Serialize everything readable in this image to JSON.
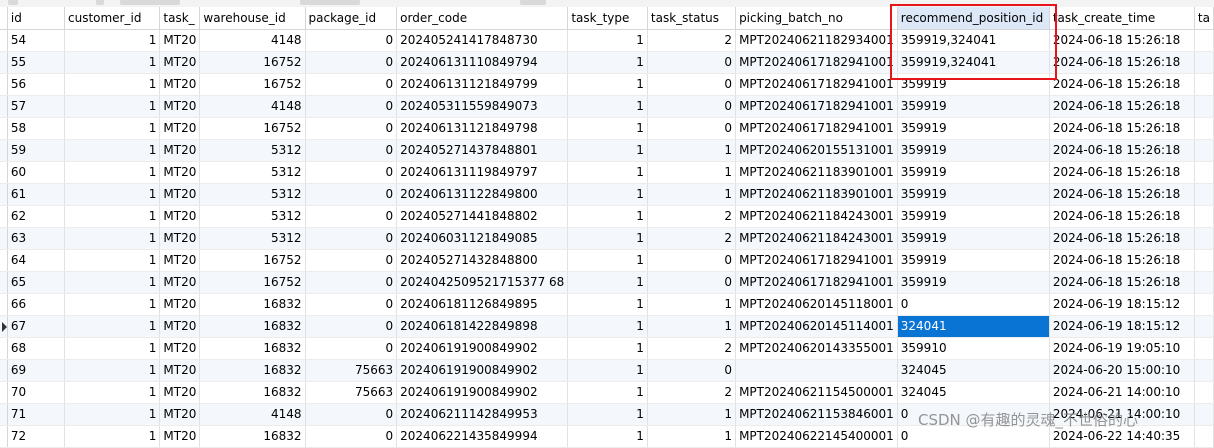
{
  "columns": [
    {
      "key": "id",
      "label": "id",
      "align": "left"
    },
    {
      "key": "customer_id",
      "label": "customer_id",
      "align": "right"
    },
    {
      "key": "task",
      "label": "task_",
      "align": "left"
    },
    {
      "key": "warehouse_id",
      "label": "warehouse_id",
      "align": "right"
    },
    {
      "key": "package_id",
      "label": "package_id",
      "align": "right"
    },
    {
      "key": "order_code",
      "label": "order_code",
      "align": "left"
    },
    {
      "key": "task_type",
      "label": "task_type",
      "align": "right"
    },
    {
      "key": "task_status",
      "label": "task_status",
      "align": "right"
    },
    {
      "key": "picking_batch_no",
      "label": "picking_batch_no",
      "align": "left"
    },
    {
      "key": "recommend_position_id",
      "label": "recommend_position_id",
      "align": "left"
    },
    {
      "key": "task_create_time",
      "label": "task_create_time",
      "align": "left"
    },
    {
      "key": "extra",
      "label": "ta",
      "align": "left"
    }
  ],
  "rows": [
    {
      "id": "54",
      "customer_id": "1",
      "task": "MT20",
      "warehouse_id": "4148",
      "package_id": "0",
      "order_code": "202405241417848730",
      "task_type": "1",
      "task_status": "2",
      "picking_batch_no": "MPT20240621182934001",
      "recommend_position_id": "359919,324041",
      "task_create_time": "2024-06-18 15:26:18",
      "extra": ""
    },
    {
      "id": "55",
      "customer_id": "1",
      "task": "MT20",
      "warehouse_id": "16752",
      "package_id": "0",
      "order_code": "202406131110849794",
      "task_type": "1",
      "task_status": "0",
      "picking_batch_no": "MPT20240617182941001",
      "recommend_position_id": "359919,324041",
      "task_create_time": "2024-06-18 15:26:18",
      "extra": ""
    },
    {
      "id": "56",
      "customer_id": "1",
      "task": "MT20",
      "warehouse_id": "16752",
      "package_id": "0",
      "order_code": "202406131121849799",
      "task_type": "1",
      "task_status": "0",
      "picking_batch_no": "MPT20240617182941001",
      "recommend_position_id": "359919",
      "task_create_time": "2024-06-18 15:26:18",
      "extra": ""
    },
    {
      "id": "57",
      "customer_id": "1",
      "task": "MT20",
      "warehouse_id": "4148",
      "package_id": "0",
      "order_code": "202405311559849073",
      "task_type": "1",
      "task_status": "0",
      "picking_batch_no": "MPT20240617182941001",
      "recommend_position_id": "359919",
      "task_create_time": "2024-06-18 15:26:18",
      "extra": ""
    },
    {
      "id": "58",
      "customer_id": "1",
      "task": "MT20",
      "warehouse_id": "16752",
      "package_id": "0",
      "order_code": "202406131121849798",
      "task_type": "1",
      "task_status": "0",
      "picking_batch_no": "MPT20240617182941001",
      "recommend_position_id": "359919",
      "task_create_time": "2024-06-18 15:26:18",
      "extra": ""
    },
    {
      "id": "59",
      "customer_id": "1",
      "task": "MT20",
      "warehouse_id": "5312",
      "package_id": "0",
      "order_code": "202405271437848801",
      "task_type": "1",
      "task_status": "1",
      "picking_batch_no": "MPT20240620155131001",
      "recommend_position_id": "359919",
      "task_create_time": "2024-06-18 15:26:18",
      "extra": ""
    },
    {
      "id": "60",
      "customer_id": "1",
      "task": "MT20",
      "warehouse_id": "5312",
      "package_id": "0",
      "order_code": "202406131119849797",
      "task_type": "1",
      "task_status": "1",
      "picking_batch_no": "MPT20240621183901001",
      "recommend_position_id": "359919",
      "task_create_time": "2024-06-18 15:26:18",
      "extra": ""
    },
    {
      "id": "61",
      "customer_id": "1",
      "task": "MT20",
      "warehouse_id": "5312",
      "package_id": "0",
      "order_code": "202406131122849800",
      "task_type": "1",
      "task_status": "1",
      "picking_batch_no": "MPT20240621183901001",
      "recommend_position_id": "359919",
      "task_create_time": "2024-06-18 15:26:18",
      "extra": ""
    },
    {
      "id": "62",
      "customer_id": "1",
      "task": "MT20",
      "warehouse_id": "5312",
      "package_id": "0",
      "order_code": "202405271441848802",
      "task_type": "1",
      "task_status": "2",
      "picking_batch_no": "MPT20240621184243001",
      "recommend_position_id": "359919",
      "task_create_time": "2024-06-18 15:26:18",
      "extra": ""
    },
    {
      "id": "63",
      "customer_id": "1",
      "task": "MT20",
      "warehouse_id": "5312",
      "package_id": "0",
      "order_code": "202406031121849085",
      "task_type": "1",
      "task_status": "2",
      "picking_batch_no": "MPT20240621184243001",
      "recommend_position_id": "359919",
      "task_create_time": "2024-06-18 15:26:18",
      "extra": ""
    },
    {
      "id": "64",
      "customer_id": "1",
      "task": "MT20",
      "warehouse_id": "16752",
      "package_id": "0",
      "order_code": "202405271432848800",
      "task_type": "1",
      "task_status": "0",
      "picking_batch_no": "MPT20240617182941001",
      "recommend_position_id": "359919",
      "task_create_time": "2024-06-18 15:26:18",
      "extra": ""
    },
    {
      "id": "65",
      "customer_id": "1",
      "task": "MT20",
      "warehouse_id": "16752",
      "package_id": "0",
      "order_code": "2024042509521715377 68",
      "task_type": "1",
      "task_status": "0",
      "picking_batch_no": "MPT20240617182941001",
      "recommend_position_id": "359919",
      "task_create_time": "2024-06-18 15:26:18",
      "extra": ""
    },
    {
      "id": "66",
      "customer_id": "1",
      "task": "MT20",
      "warehouse_id": "16832",
      "package_id": "0",
      "order_code": "202406181126849895",
      "task_type": "1",
      "task_status": "1",
      "picking_batch_no": "MPT20240620145118001",
      "recommend_position_id": "0",
      "task_create_time": "2024-06-19 18:15:12",
      "extra": ""
    },
    {
      "id": "67",
      "customer_id": "1",
      "task": "MT20",
      "warehouse_id": "16832",
      "package_id": "0",
      "order_code": "202406181422849898",
      "task_type": "1",
      "task_status": "1",
      "picking_batch_no": "MPT20240620145114001",
      "recommend_position_id": "324041",
      "task_create_time": "2024-06-19 18:15:12",
      "extra": ""
    },
    {
      "id": "68",
      "customer_id": "1",
      "task": "MT20",
      "warehouse_id": "16832",
      "package_id": "0",
      "order_code": "202406191900849902",
      "task_type": "1",
      "task_status": "2",
      "picking_batch_no": "MPT20240620143355001",
      "recommend_position_id": "359910",
      "task_create_time": "2024-06-19 19:05:10",
      "extra": ""
    },
    {
      "id": "69",
      "customer_id": "1",
      "task": "MT20",
      "warehouse_id": "16832",
      "package_id": "75663",
      "order_code": "202406191900849902",
      "task_type": "1",
      "task_status": "0",
      "picking_batch_no": "",
      "recommend_position_id": "324045",
      "task_create_time": "2024-06-20 15:00:10",
      "extra": ""
    },
    {
      "id": "70",
      "customer_id": "1",
      "task": "MT20",
      "warehouse_id": "16832",
      "package_id": "75663",
      "order_code": "202406191900849902",
      "task_type": "1",
      "task_status": "2",
      "picking_batch_no": "MPT20240621154500001",
      "recommend_position_id": "324045",
      "task_create_time": "2024-06-21 14:00:10",
      "extra": ""
    },
    {
      "id": "71",
      "customer_id": "1",
      "task": "MT20",
      "warehouse_id": "4148",
      "package_id": "0",
      "order_code": "202406211142849953",
      "task_type": "1",
      "task_status": "1",
      "picking_batch_no": "MPT20240621153846001",
      "recommend_position_id": "0",
      "task_create_time": "2024-06-21 14:00:10",
      "extra": ""
    },
    {
      "id": "72",
      "customer_id": "1",
      "task": "MT20",
      "warehouse_id": "16832",
      "package_id": "0",
      "order_code": "202406221435849994",
      "task_type": "1",
      "task_status": "1",
      "picking_batch_no": "MPT20240622145400001",
      "recommend_position_id": "0",
      "task_create_time": "2024-06-22 14:40:35",
      "extra": ""
    }
  ],
  "current_row_id": "67",
  "selected_cell": {
    "row_id": "67",
    "column": "recommend_position_id"
  },
  "sorted_column": "recommend_position_id",
  "watermark": "CSDN @有趣的灵魂_不世俗的心",
  "colors": {
    "selection": "#0a74d4",
    "highlight_box": "#e8141c",
    "alt_row": "#f4f8fc",
    "sorted_header": "#dce8f7"
  }
}
